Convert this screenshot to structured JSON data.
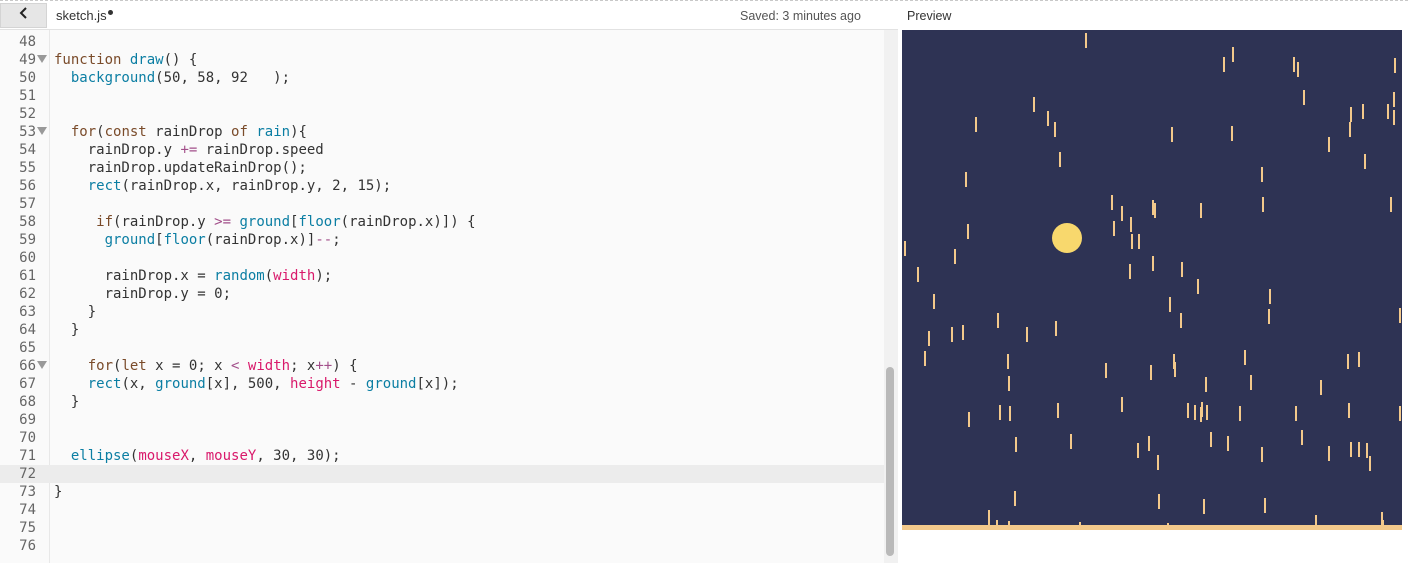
{
  "header": {
    "back_icon": "chevron-left-icon",
    "file_name": "sketch.js",
    "saved_status": "Saved: 3 minutes ago"
  },
  "preview": {
    "label": "Preview",
    "background_color": "#2e3354",
    "drop_color": "#f3c98b",
    "sun_color": "#f8d86d"
  },
  "editor": {
    "active_line": 72,
    "line_numbers": [
      "48",
      "49",
      "50",
      "51",
      "52",
      "53",
      "54",
      "55",
      "56",
      "57",
      "58",
      "59",
      "60",
      "61",
      "62",
      "63",
      "64",
      "65",
      "66",
      "67",
      "68",
      "69",
      "70",
      "71",
      "72",
      "73",
      "74",
      "75",
      "76"
    ],
    "lines": [
      "",
      "function draw() {",
      "  background(50, 58, 92   );",
      "",
      "",
      "  for(const rainDrop of rain){",
      "    rainDrop.y += rainDrop.speed",
      "    rainDrop.updateRainDrop();",
      "    rect(rainDrop.x, rainDrop.y, 2, 15);",
      "",
      "     if(rainDrop.y >= ground[floor(rainDrop.x)]) {",
      "      ground[floor(rainDrop.x)]--;",
      "",
      "      rainDrop.x = random(width);",
      "      rainDrop.y = 0;",
      "    }",
      "  }",
      "",
      "    for(let x = 0; x < width; x++) {",
      "    rect(x, ground[x], 500, height - ground[x]);",
      "  }",
      "",
      "",
      "  ellipse(mouseX, mouseY, 30, 30);",
      "",
      "}",
      "",
      "",
      ""
    ]
  }
}
